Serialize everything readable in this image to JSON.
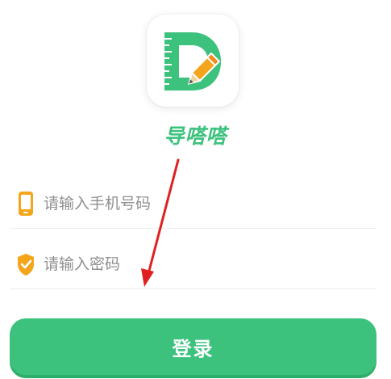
{
  "app": {
    "name": "导嗒嗒",
    "logo_icon": "ruler-d-pencil-icon"
  },
  "form": {
    "phone": {
      "placeholder": "请输入手机号码",
      "value": "",
      "icon": "phone-icon"
    },
    "password": {
      "placeholder": "请输入密码",
      "value": "",
      "icon": "shield-check-icon"
    },
    "login_label": "登录"
  },
  "colors": {
    "brand_green": "#3cc27d",
    "icon_orange": "#f5a51c",
    "annotation_red": "#e02020"
  }
}
